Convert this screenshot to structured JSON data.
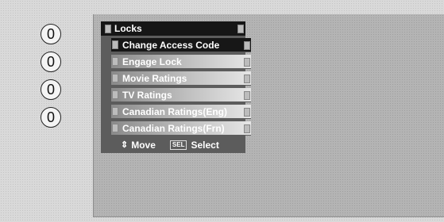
{
  "pins": [
    "0",
    "0",
    "0",
    "0"
  ],
  "menu": {
    "title": "Locks",
    "items": [
      {
        "label": "Change Access Code",
        "selected": true
      },
      {
        "label": "Engage Lock",
        "selected": false
      },
      {
        "label": "Movie Ratings",
        "selected": false
      },
      {
        "label": "TV Ratings",
        "selected": false
      },
      {
        "label": "Canadian Ratings(Eng)",
        "selected": false
      },
      {
        "label": "Canadian Ratings(Frn)",
        "selected": false
      }
    ]
  },
  "footer": {
    "move_icon": "⇕",
    "move_label": "Move",
    "sel_key": "SEL",
    "select_label": "Select"
  }
}
